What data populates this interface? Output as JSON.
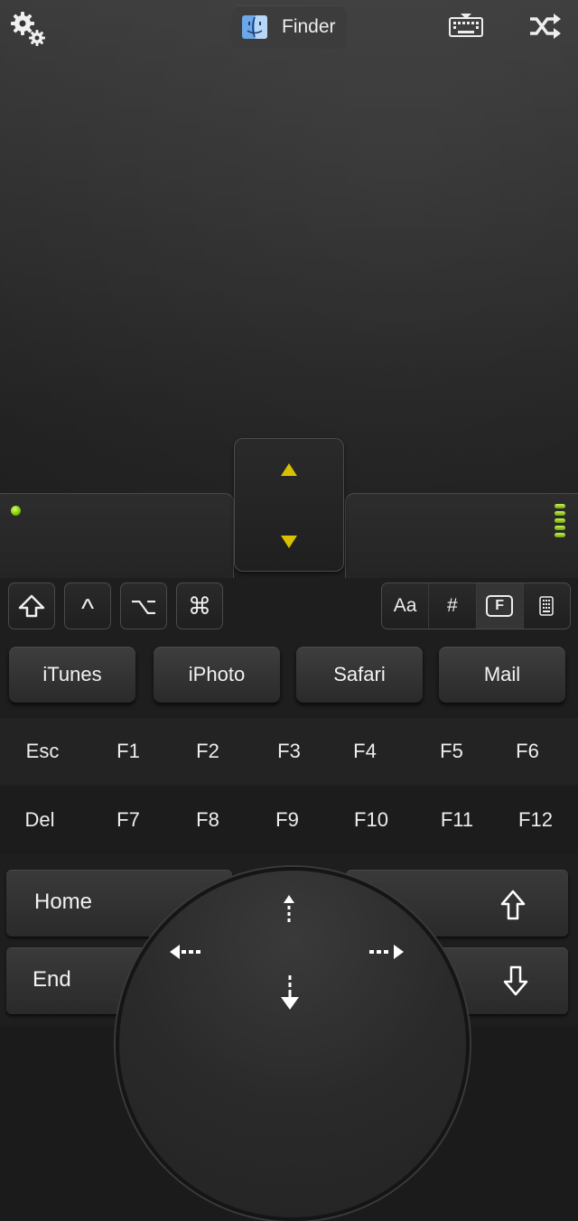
{
  "top_bar": {
    "settings_icon": "gears-icon",
    "active_app": "Finder",
    "active_app_icon": "finder-icon",
    "keyboard_icon": "keyboard-hide-icon",
    "shuffle_icon": "shuffle-icon"
  },
  "scroll": {
    "up_icon": "triangle-up-icon",
    "down_icon": "triangle-down-icon",
    "arrow_color": "#d9c100"
  },
  "status": {
    "led_color": "#7fc600",
    "level_segments": 5
  },
  "modifiers": {
    "shift": "⇧",
    "control": "^",
    "option": "⌥",
    "command": "⌘"
  },
  "keyboard_modes": {
    "letters": "Aa",
    "symbols": "#",
    "function": "F",
    "keypad_icon": "keypad-icon"
  },
  "apps": [
    "iTunes",
    "iPhoto",
    "Safari",
    "Mail"
  ],
  "fn_row_1": [
    "Esc",
    "F1",
    "F2",
    "F3",
    "F4",
    "F5",
    "F6"
  ],
  "fn_row_2": [
    "Del",
    "F7",
    "F8",
    "F9",
    "F10",
    "F11",
    "F12"
  ],
  "navigation": {
    "home": "Home",
    "end": "End",
    "page_up_icon": "page-up-arrow-icon",
    "page_down_icon": "page-down-arrow-icon",
    "up_icon": "arrow-up-icon",
    "down_icon": "arrow-down-icon",
    "left_icon": "arrow-left-icon",
    "right_icon": "arrow-right-icon"
  }
}
